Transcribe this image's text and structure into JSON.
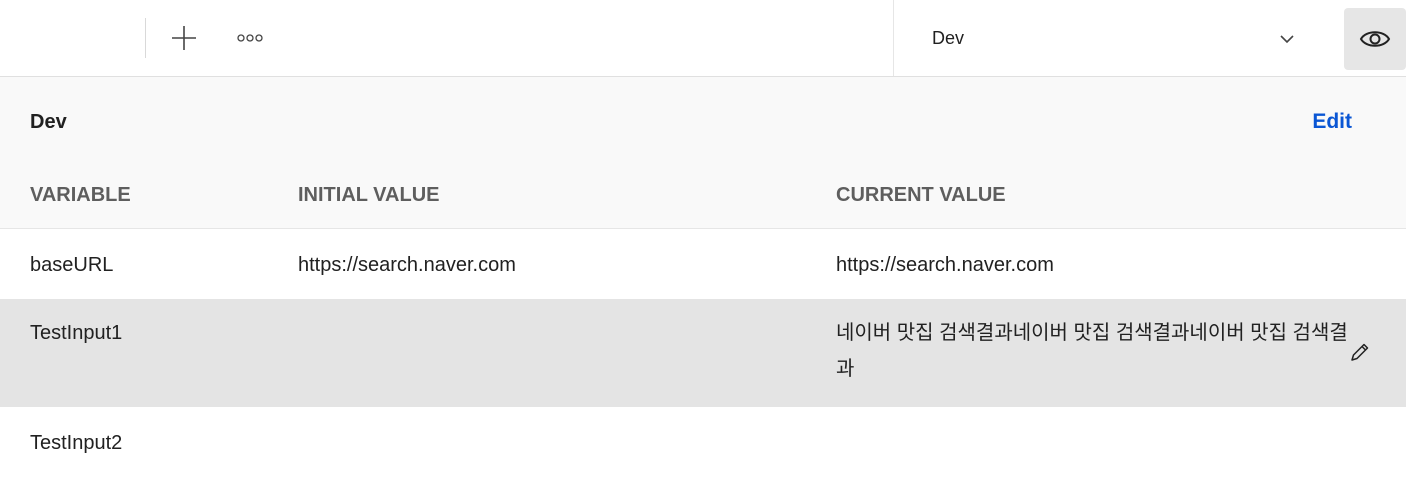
{
  "toolbar": {
    "add_icon": "plus-icon",
    "more_icon": "more-horizontal-icon",
    "environment_selector": {
      "selected": "Dev",
      "icon": "chevron-down-icon"
    },
    "quick_look_icon": "eye-icon"
  },
  "environment_panel": {
    "title": "Dev",
    "edit_label": "Edit",
    "edit_color": "#0a56d4",
    "columns": [
      "VARIABLE",
      "INITIAL VALUE",
      "CURRENT VALUE"
    ],
    "rows": [
      {
        "variable": "baseURL",
        "initial_value": "https://search.naver.com",
        "current_value": "https://search.naver.com"
      },
      {
        "variable": "TestInput1",
        "initial_value": "",
        "current_value": "네이버 맛집 검색결과네이버 맛집 검색결과네이버 맛집 검색결과",
        "hovered": true,
        "action_icon": "pencil-icon"
      },
      {
        "variable": "TestInput2",
        "initial_value": "",
        "current_value": ""
      }
    ]
  }
}
